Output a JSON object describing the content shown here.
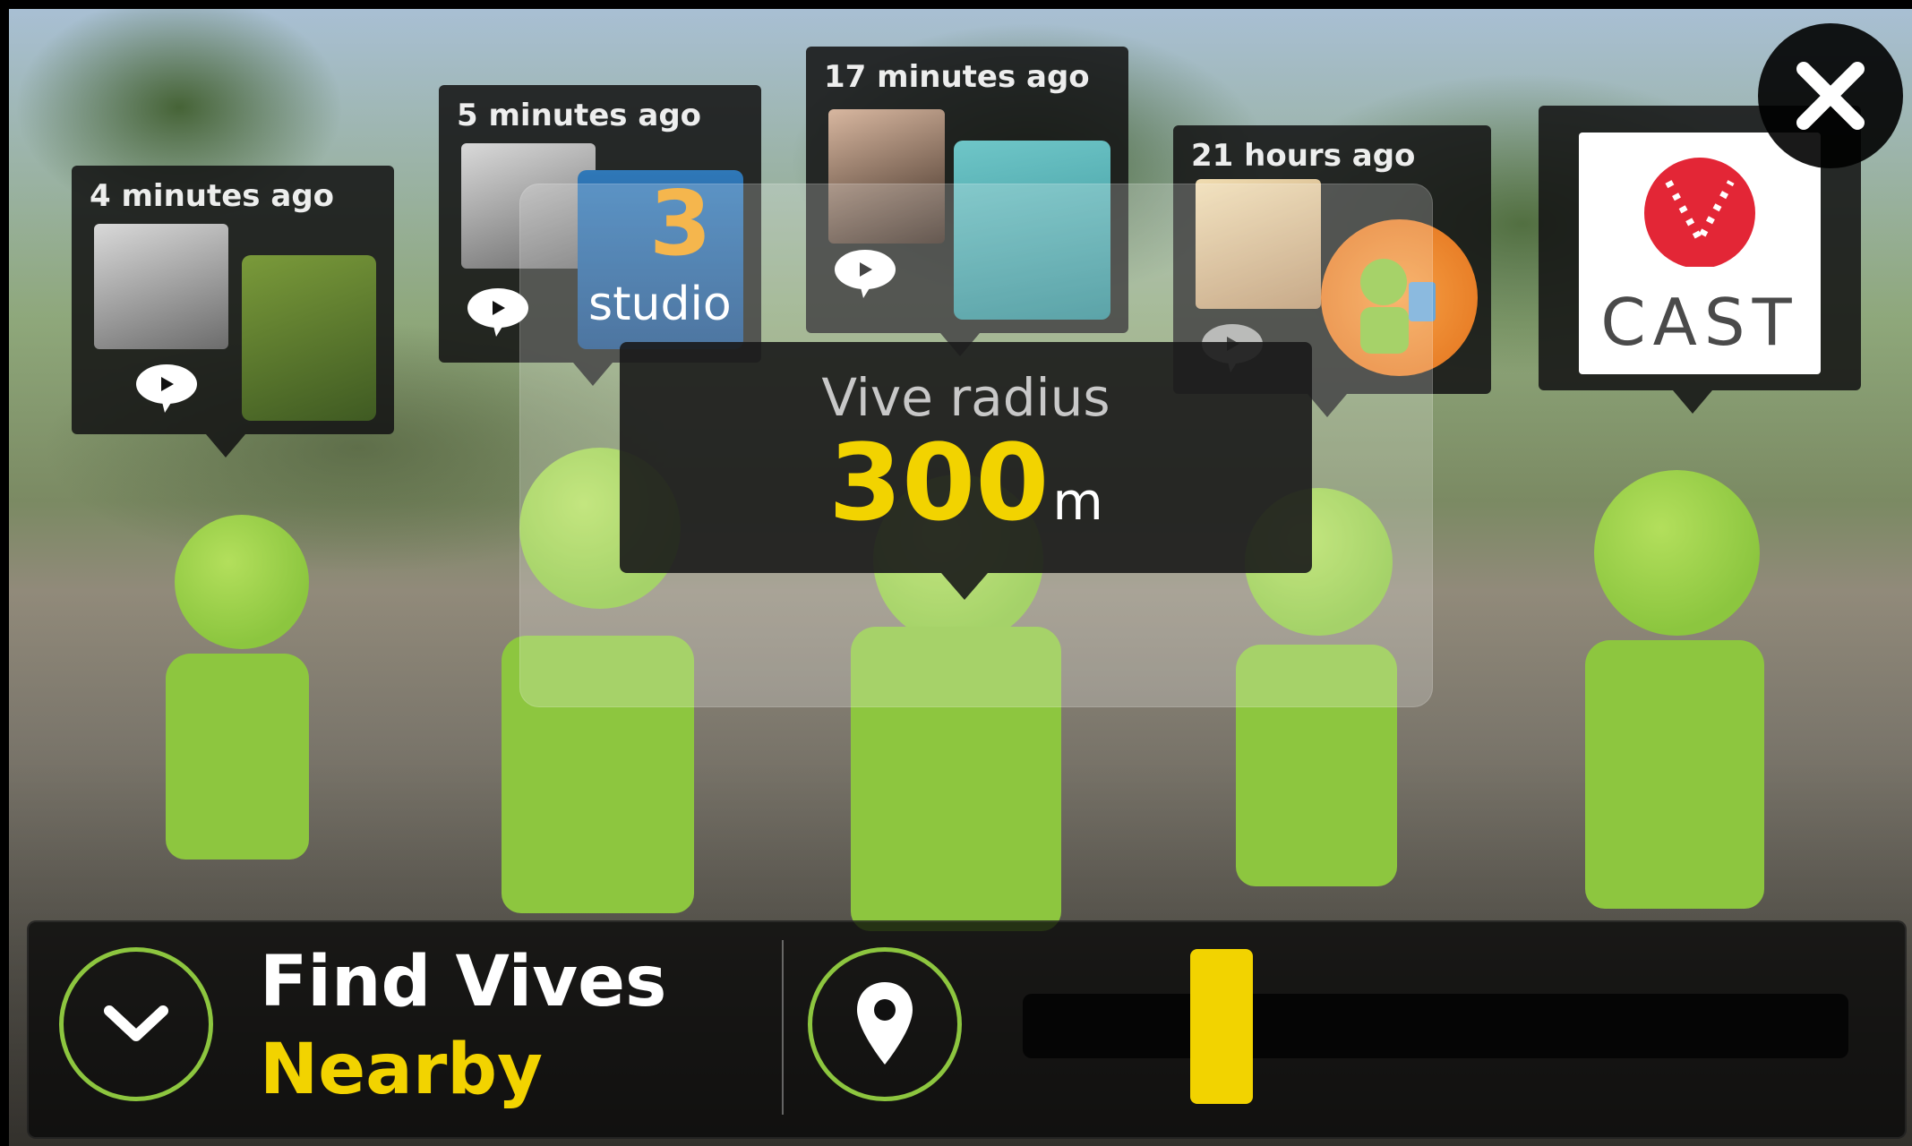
{
  "bubbles": [
    {
      "time": "4 minutes ago"
    },
    {
      "time": "5 minutes ago",
      "brand_line1": "3",
      "brand_line2": "studio"
    },
    {
      "time": "17 minutes ago"
    },
    {
      "time": "21 hours ago"
    },
    {
      "brand": "CAST"
    }
  ],
  "radius_panel": {
    "label": "Vive radius",
    "value": "300",
    "unit": "m"
  },
  "bottom_bar": {
    "title": "Find Vives",
    "subtitle": "Nearby",
    "slider": {
      "min": 0,
      "max": 1,
      "value": 0.22
    }
  },
  "colors": {
    "accent_yellow": "#f2d300",
    "marker_green": "#8dc63f",
    "panel_dark": "#191919"
  },
  "icons": [
    "close-icon",
    "chevron-down-icon",
    "map-pin-icon",
    "speech-bubble-icon"
  ]
}
